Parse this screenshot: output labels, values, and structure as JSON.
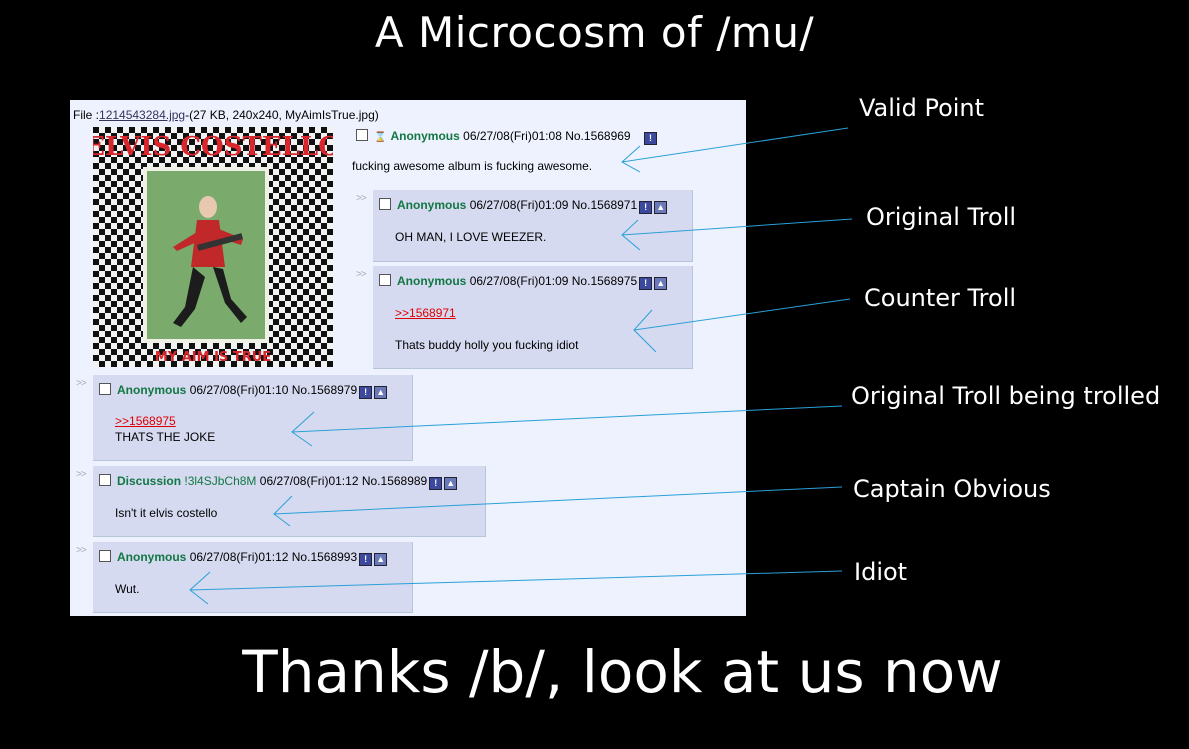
{
  "top_title": "A Microcosm of /mu/",
  "bottom_title": "Thanks /b/, look at us now",
  "file": {
    "prefix": "File :",
    "link": "1214543284.jpg",
    "info": "-(27 KB, 240x240, MyAimIsTrue.jpg)"
  },
  "album": {
    "artist": "ELVIS COSTELLO",
    "title": "MY AIM IS TRUE"
  },
  "posts": [
    {
      "name": "Anonymous",
      "datetime": "06/27/08(Fri)01:08",
      "number": "No.1568969",
      "body": "fucking awesome album is fucking awesome."
    },
    {
      "name": "Anonymous",
      "datetime": "06/27/08(Fri)01:09",
      "number": "No.1568971",
      "body": "OH MAN, I LOVE WEEZER."
    },
    {
      "name": "Anonymous",
      "datetime": "06/27/08(Fri)01:09",
      "number": "No.1568975",
      "quote": ">>1568971",
      "body": "Thats buddy holly you fucking idiot"
    },
    {
      "name": "Anonymous",
      "datetime": "06/27/08(Fri)01:10",
      "number": "No.1568979",
      "quote": ">>1568975",
      "body": "THATS THE JOKE"
    },
    {
      "name": "Discussion",
      "trip": "!3l4SJbCh8M",
      "datetime": "06/27/08(Fri)01:12",
      "number": "No.1568989",
      "body": "Isn't it elvis costello"
    },
    {
      "name": "Anonymous",
      "datetime": "06/27/08(Fri)01:12",
      "number": "No.1568993",
      "body": "Wut."
    }
  ],
  "reply_arrows": ">>",
  "report_icon": "!",
  "annotations": [
    "Valid Point",
    "Original Troll",
    "Counter Troll",
    "Original Troll being trolled",
    "Captain Obvious",
    "Idiot"
  ],
  "colors": {
    "background": "#000000",
    "board": "#eef2ff",
    "reply": "#d6daf0",
    "name": "#117743",
    "quote": "#dd0000",
    "line": "#2aa0d8"
  }
}
